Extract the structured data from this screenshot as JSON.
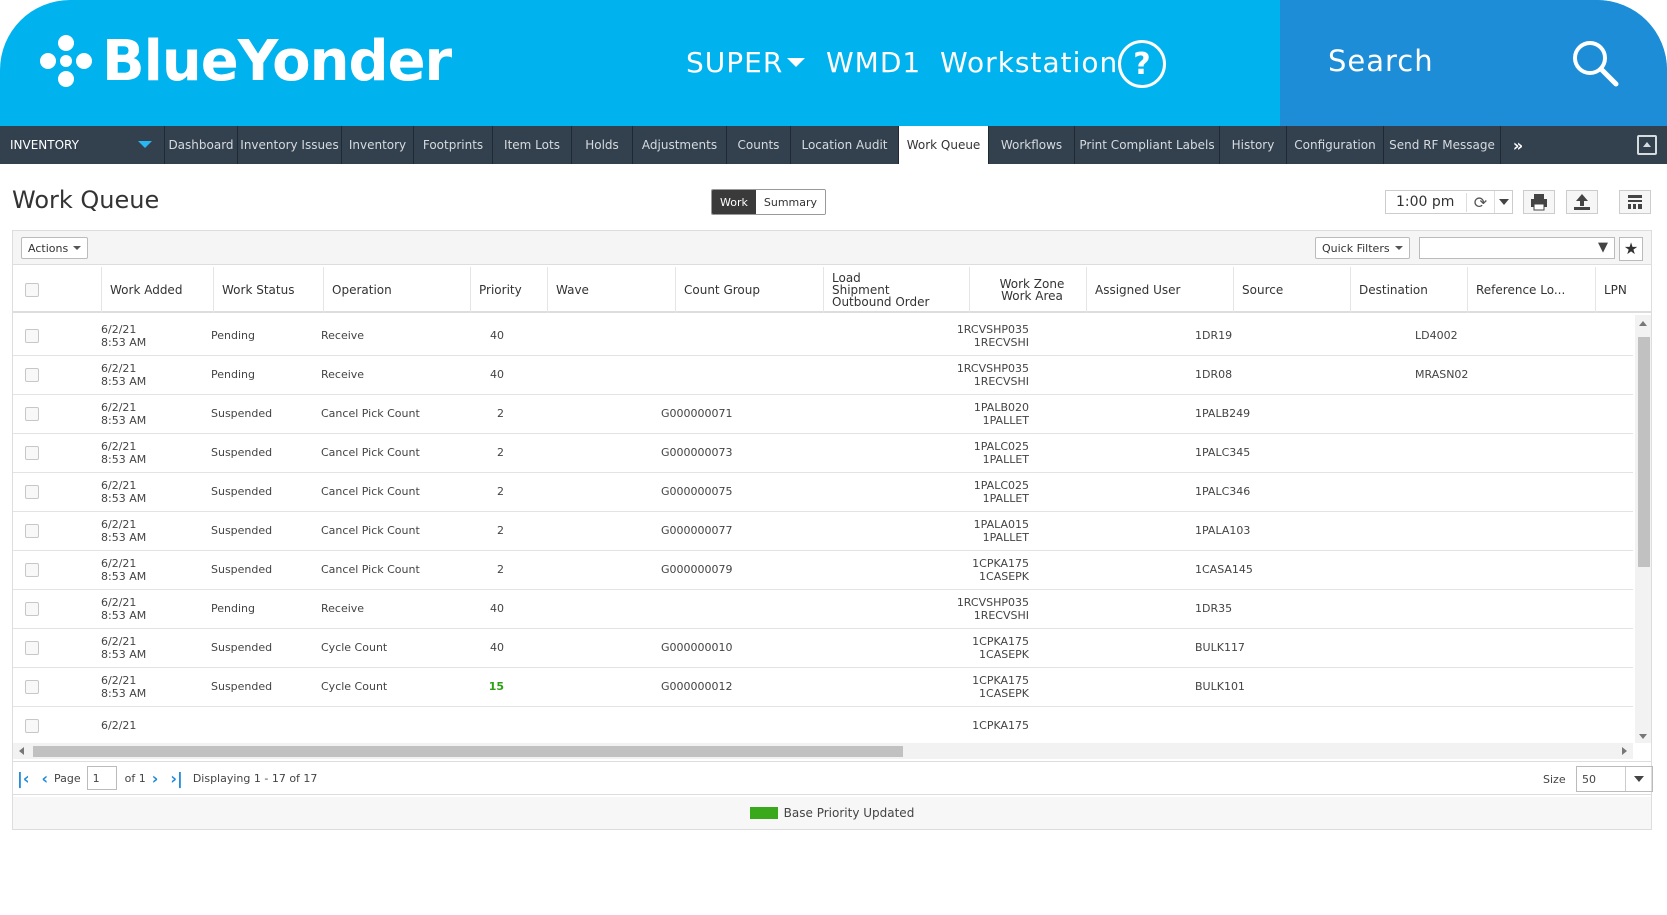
{
  "header": {
    "logo_text": "BlueYonder",
    "user": "SUPER",
    "warehouse": "WMD1",
    "workstation": "Workstation",
    "search_placeholder": "Search"
  },
  "nav": {
    "module": "INVENTORY",
    "tabs": [
      {
        "label": "Dashboard",
        "active": false
      },
      {
        "label": "Inventory Issues",
        "active": false
      },
      {
        "label": "Inventory",
        "active": false
      },
      {
        "label": "Footprints",
        "active": false
      },
      {
        "label": "Item Lots",
        "active": false
      },
      {
        "label": "Holds",
        "active": false
      },
      {
        "label": "Adjustments",
        "active": false
      },
      {
        "label": "Counts",
        "active": false
      },
      {
        "label": "Location Audit",
        "active": false
      },
      {
        "label": "Work Queue",
        "active": true
      },
      {
        "label": "Workflows",
        "active": false
      },
      {
        "label": "Print Compliant Labels",
        "active": false
      },
      {
        "label": "History",
        "active": false
      },
      {
        "label": "Configuration",
        "active": false
      },
      {
        "label": "Send RF Message",
        "active": false
      }
    ]
  },
  "page": {
    "title": "Work Queue",
    "view_work": "Work",
    "view_summary": "Summary",
    "time": "1:00 pm"
  },
  "toolbar": {
    "actions": "Actions",
    "quick_filters": "Quick Filters"
  },
  "columns": {
    "work_added": "Work Added",
    "work_status": "Work Status",
    "operation": "Operation",
    "priority": "Priority",
    "wave": "Wave",
    "count_group": "Count Group",
    "load_line1": "Load",
    "load_line2": "Shipment",
    "load_line3": "Outbound Order",
    "zone_line1": "Work Zone",
    "zone_line2": "Work Area",
    "assigned_user": "Assigned User",
    "source": "Source",
    "destination": "Destination",
    "reference": "Reference Lo...",
    "lpn": "LPN"
  },
  "rows": [
    {
      "date": "6/2/21",
      "time": "8:53 AM",
      "status": "Pending",
      "operation": "Receive",
      "priority": "40",
      "priority_updated": false,
      "count_group": "",
      "zone": "1RCVSHP035",
      "area": "1RECVSHI",
      "source": "1DR19",
      "reference": "LD4002"
    },
    {
      "date": "6/2/21",
      "time": "8:53 AM",
      "status": "Pending",
      "operation": "Receive",
      "priority": "40",
      "priority_updated": false,
      "count_group": "",
      "zone": "1RCVSHP035",
      "area": "1RECVSHI",
      "source": "1DR08",
      "reference": "MRASN02"
    },
    {
      "date": "6/2/21",
      "time": "8:53 AM",
      "status": "Suspended",
      "operation": "Cancel Pick Count",
      "priority": "2",
      "priority_updated": false,
      "count_group": "G000000071",
      "zone": "1PALB020",
      "area": "1PALLET",
      "source": "1PALB249",
      "reference": ""
    },
    {
      "date": "6/2/21",
      "time": "8:53 AM",
      "status": "Suspended",
      "operation": "Cancel Pick Count",
      "priority": "2",
      "priority_updated": false,
      "count_group": "G000000073",
      "zone": "1PALC025",
      "area": "1PALLET",
      "source": "1PALC345",
      "reference": ""
    },
    {
      "date": "6/2/21",
      "time": "8:53 AM",
      "status": "Suspended",
      "operation": "Cancel Pick Count",
      "priority": "2",
      "priority_updated": false,
      "count_group": "G000000075",
      "zone": "1PALC025",
      "area": "1PALLET",
      "source": "1PALC346",
      "reference": ""
    },
    {
      "date": "6/2/21",
      "time": "8:53 AM",
      "status": "Suspended",
      "operation": "Cancel Pick Count",
      "priority": "2",
      "priority_updated": false,
      "count_group": "G000000077",
      "zone": "1PALA015",
      "area": "1PALLET",
      "source": "1PALA103",
      "reference": ""
    },
    {
      "date": "6/2/21",
      "time": "8:53 AM",
      "status": "Suspended",
      "operation": "Cancel Pick Count",
      "priority": "2",
      "priority_updated": false,
      "count_group": "G000000079",
      "zone": "1CPKA175",
      "area": "1CASEPK",
      "source": "1CASA145",
      "reference": ""
    },
    {
      "date": "6/2/21",
      "time": "8:53 AM",
      "status": "Pending",
      "operation": "Receive",
      "priority": "40",
      "priority_updated": false,
      "count_group": "",
      "zone": "1RCVSHP035",
      "area": "1RECVSHI",
      "source": "1DR35",
      "reference": ""
    },
    {
      "date": "6/2/21",
      "time": "8:53 AM",
      "status": "Suspended",
      "operation": "Cycle Count",
      "priority": "40",
      "priority_updated": false,
      "count_group": "G000000010",
      "zone": "1CPKA175",
      "area": "1CASEPK",
      "source": "BULK117",
      "reference": ""
    },
    {
      "date": "6/2/21",
      "time": "8:53 AM",
      "status": "Suspended",
      "operation": "Cycle Count",
      "priority": "15",
      "priority_updated": true,
      "count_group": "G000000012",
      "zone": "1CPKA175",
      "area": "1CASEPK",
      "source": "BULK101",
      "reference": ""
    },
    {
      "date": "6/2/21",
      "time": "",
      "status": "",
      "operation": "",
      "priority": "",
      "priority_updated": false,
      "count_group": "",
      "zone": "1CPKA175",
      "area": "",
      "source": "",
      "reference": ""
    }
  ],
  "pager": {
    "page_label": "Page",
    "page_value": "1",
    "of_label": "of 1",
    "displaying": "Displaying 1 - 17 of 17",
    "size_label": "Size",
    "size_value": "50"
  },
  "legend": {
    "label": "Base Priority Updated",
    "color": "#39a81a"
  },
  "colors": {
    "brand": "#00b2ee",
    "search_bg": "#1c8dd6",
    "navbar": "#33404e",
    "accent": "#1d8bd8"
  }
}
